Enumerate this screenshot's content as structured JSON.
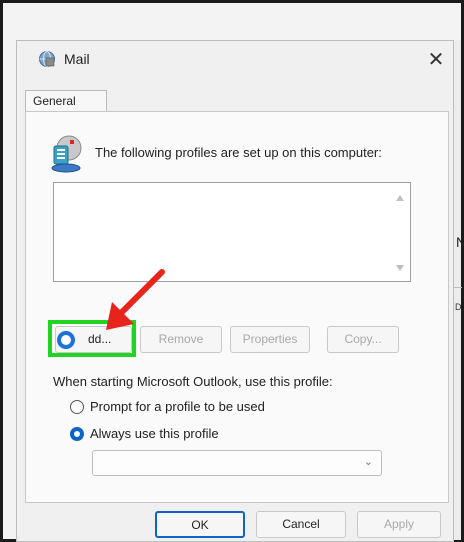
{
  "window": {
    "title": "Mail",
    "close_glyph": "✕"
  },
  "tabs": [
    {
      "label": "General"
    }
  ],
  "profiles": {
    "heading": "The following profiles are set up on this computer:",
    "items": []
  },
  "profile_buttons": {
    "add": "Add...",
    "add_visible": " dd...",
    "remove": "Remove",
    "properties": "Properties",
    "copy": "Copy..."
  },
  "startup": {
    "heading": "When starting Microsoft Outlook, use this profile:",
    "options": [
      {
        "label": "Prompt for a profile to be used",
        "checked": false
      },
      {
        "label": "Always use this profile",
        "checked": true
      }
    ],
    "selected_profile": ""
  },
  "footer_buttons": {
    "ok": "OK",
    "cancel": "Cancel",
    "apply": "Apply"
  },
  "background": {
    "partial_letter": "N",
    "partial_text": "D"
  },
  "colors": {
    "highlight": "#22d422",
    "arrow": "#e8231c",
    "accent": "#0e63c7"
  },
  "icons": {
    "title": "mail-globe-icon",
    "profiles": "profiles-card-icon",
    "combo": "chevron-down-icon"
  }
}
